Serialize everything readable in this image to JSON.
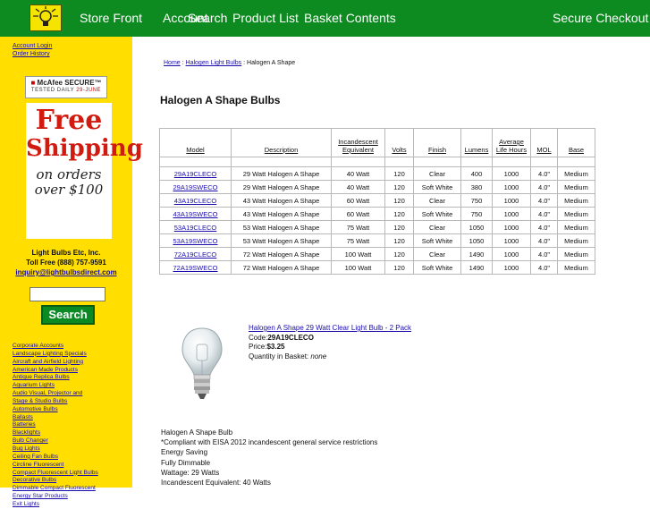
{
  "nav": {
    "store_front": "Store Front",
    "account": "Account",
    "search": "Search",
    "product_list": "Product List",
    "basket_contents": "Basket Contents",
    "secure_checkout": "Secure Checkout"
  },
  "sidebar": {
    "account_login": "Account Login",
    "order_history": "Order History",
    "mcafee_line1": "McAfee SECURE",
    "mcafee_tm": "™",
    "mcafee_line2_prefix": "TESTED DAILY",
    "mcafee_line2_date": "29-JUNE",
    "free_shipping": {
      "free": "Free",
      "shipping": "Shipping",
      "on_orders": "on orders",
      "over": "over $100"
    },
    "company_name": "Light Bulbs Etc, Inc.",
    "phone": "Toll Free (888) 757-9591",
    "email": "inquiry@lightbulbsdirect.com",
    "search_value": "",
    "search_button": "Search",
    "categories": [
      "Corporate Accounts",
      "Landscape Lighting Specials",
      "Aircraft and Airfield Lighting",
      "American Made Products",
      "Antique Replica Bulbs",
      "Aquarium Lights",
      "Audio Visual, Projector and",
      "Stage & Studio Bulbs",
      "Automotive Bulbs",
      "Ballasts",
      "Batteries",
      "Blacklights",
      "Bulb Changer",
      "Bug Lights",
      "Ceiling Fan Bulbs",
      "Circline Fluorescent",
      "Compact Fluorescent Light Bulbs",
      "Decorative Bulbs",
      "Dimmable Compact Fluorescent",
      "Energy Star Products",
      "Exit Lights"
    ]
  },
  "breadcrumb": {
    "home": "Home",
    "sep1": " : ",
    "category": "Halogen Light Bulbs",
    "sep2": " : ",
    "current": "Halogen A Shape"
  },
  "page_title": "Halogen A Shape Bulbs",
  "table": {
    "headers": [
      "Model",
      "Description",
      "Incandescent Equivalent",
      "Volts",
      "Finish",
      "Lumens",
      "Average Life Hours",
      "MOL",
      "Base"
    ],
    "header_lines": [
      [
        "",
        "Model"
      ],
      [
        "",
        "Description"
      ],
      [
        "Incandescent",
        "Equivalent"
      ],
      [
        "",
        "Volts"
      ],
      [
        "",
        "Finish"
      ],
      [
        "",
        "Lumens"
      ],
      [
        "Average",
        "Life Hours"
      ],
      [
        "",
        "MOL"
      ],
      [
        "",
        "Base"
      ]
    ],
    "rows": [
      [
        "29A19CLECO",
        "29 Watt Halogen A Shape",
        "40 Watt",
        "120",
        "Clear",
        "400",
        "1000",
        "4.0\"",
        "Medium"
      ],
      [
        "29A19SWECO",
        "29 Watt Halogen A Shape",
        "40 Watt",
        "120",
        "Soft White",
        "380",
        "1000",
        "4.0\"",
        "Medium"
      ],
      [
        "43A19CLECO",
        "43 Watt Halogen A Shape",
        "60 Watt",
        "120",
        "Clear",
        "750",
        "1000",
        "4.0\"",
        "Medium"
      ],
      [
        "43A19SWECO",
        "43 Watt Halogen A Shape",
        "60 Watt",
        "120",
        "Soft White",
        "750",
        "1000",
        "4.0\"",
        "Medium"
      ],
      [
        "53A19CLECO",
        "53 Watt Halogen A Shape",
        "75 Watt",
        "120",
        "Clear",
        "1050",
        "1000",
        "4.0\"",
        "Medium"
      ],
      [
        "53A19SWECO",
        "53 Watt Halogen A Shape",
        "75 Watt",
        "120",
        "Soft White",
        "1050",
        "1000",
        "4.0\"",
        "Medium"
      ],
      [
        "72A19CLECO",
        "72 Watt Halogen A Shape",
        "100 Watt",
        "120",
        "Clear",
        "1490",
        "1000",
        "4.0\"",
        "Medium"
      ],
      [
        "72A19SWECO",
        "72 Watt Halogen A Shape",
        "100 Watt",
        "120",
        "Soft White",
        "1490",
        "1000",
        "4.0\"",
        "Medium"
      ]
    ]
  },
  "featured": {
    "title": "Halogen A Shape 29 Watt Clear Light Bulb - 2 Pack",
    "code_label": "Code:",
    "code": "29A19CLECO",
    "price_label": "Price:",
    "price": "$3.25",
    "qty_label": "Quantity in Basket: ",
    "qty": "none"
  },
  "description": [
    "Halogen A Shape Bulb",
    "*Compliant with EISA 2012 incandescent general service restrictions",
    "Energy Saving",
    "Fully Dimmable",
    "Wattage: 29 Watts",
    "Incandescent Equivalent: 40 Watts"
  ],
  "colors": {
    "nav_bg": "#0d8a20",
    "sidebar_bg": "#ffde00",
    "link": "#1a0dab",
    "free_shipping_red": "#d21b10"
  },
  "icons": {
    "logo": "light-bulb-logo-icon",
    "product": "halogen-bulb-image"
  }
}
